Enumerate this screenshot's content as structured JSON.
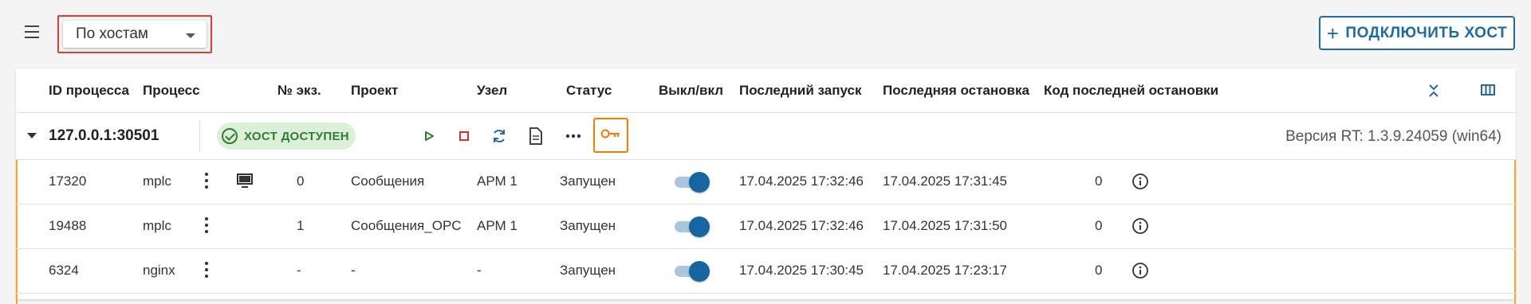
{
  "toolbar": {
    "grouping_select": {
      "value": "По хостам"
    },
    "connect_host_label": "ПОДКЛЮЧИТЬ ХОСТ"
  },
  "columns": {
    "pid": "ID процесса",
    "process": "Процесс",
    "instance": "№ экз.",
    "project": "Проект",
    "node": "Узел",
    "status": "Статус",
    "toggle": "Выкл/вкл",
    "last_start": "Последний запуск",
    "last_stop": "Последняя остановка",
    "last_stop_code": "Код последней остановки"
  },
  "host_group": {
    "name": "127.0.0.1:30501",
    "status_badge": "ХОСТ ДОСТУПЕН",
    "version": "Версия RT: 1.3.9.24059 (win64)",
    "accent_color": "#f5a623"
  },
  "rows": [
    {
      "pid": "17320",
      "process": "mplc",
      "has_monitor_icon": true,
      "instance": "0",
      "project": "Сообщения",
      "node": "АРМ 1",
      "status": "Запущен",
      "enabled": true,
      "last_start": "17.04.2025 17:32:46",
      "last_stop": "17.04.2025 17:31:45",
      "last_stop_code": "0"
    },
    {
      "pid": "19488",
      "process": "mplc",
      "has_monitor_icon": false,
      "instance": "1",
      "project": "Сообщения_OPC",
      "node": "АРМ 1",
      "status": "Запущен",
      "enabled": true,
      "last_start": "17.04.2025 17:32:46",
      "last_stop": "17.04.2025 17:31:50",
      "last_stop_code": "0"
    },
    {
      "pid": "6324",
      "process": "nginx",
      "has_monitor_icon": false,
      "instance": "-",
      "project": "-",
      "node": "-",
      "status": "Запущен",
      "enabled": true,
      "last_start": "17.04.2025 17:30:45",
      "last_stop": "17.04.2025 17:23:17",
      "last_stop_code": "0"
    }
  ]
}
